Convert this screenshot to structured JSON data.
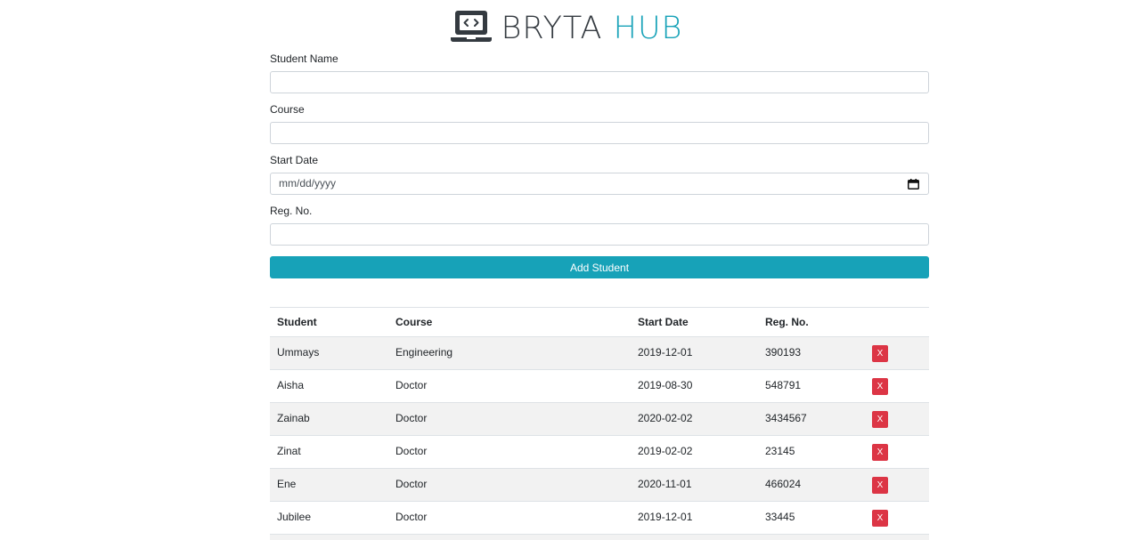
{
  "brand": {
    "word1": "BRYTA",
    "word2": "HUB",
    "logo_icon": "laptop-code-icon",
    "accent_color": "#17a2b8"
  },
  "form": {
    "name_label": "Student Name",
    "name_value": "",
    "course_label": "Course",
    "course_value": "",
    "date_label": "Start Date",
    "date_placeholder": "mm/dd/yyyy",
    "date_icon": "calendar-icon",
    "reg_label": "Reg. No.",
    "reg_value": "",
    "submit_label": "Add Student"
  },
  "table": {
    "headers": [
      "Student",
      "Course",
      "Start Date",
      "Reg. No."
    ],
    "delete_label": "X",
    "delete_color": "#dc3545",
    "rows": [
      [
        "Ummays",
        "Engineering",
        "2019-12-01",
        "390193"
      ],
      [
        "Aisha",
        "Doctor",
        "2019-08-30",
        "548791"
      ],
      [
        "Zainab",
        "Doctor",
        "2020-02-02",
        "3434567"
      ],
      [
        "Zinat",
        "Doctor",
        "2019-02-02",
        "23145"
      ],
      [
        "Ene",
        "Doctor",
        "2020-11-01",
        "466024"
      ],
      [
        "Jubilee",
        "Doctor",
        "2019-12-01",
        "33445"
      ]
    ]
  }
}
